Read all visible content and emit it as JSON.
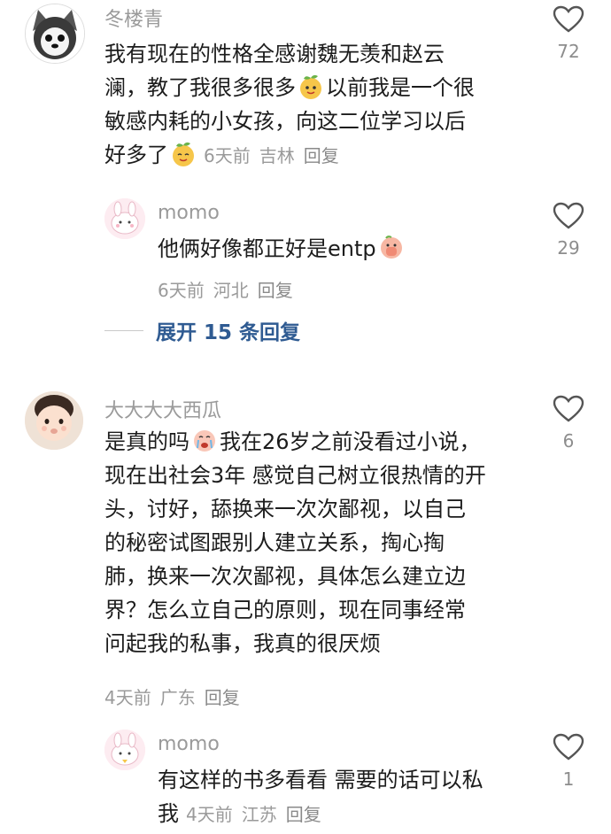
{
  "comments": [
    {
      "username": "冬楼青",
      "lines": [
        "我有现在的性格全感谢魏无羡和赵云",
        "澜，教了我很多很多",
        "以前我是一个很",
        "敏感内耗的小女孩，向这二位学习以后",
        "好多了"
      ],
      "time": "6天前",
      "location": "吉林",
      "reply": "回复",
      "likes": "72"
    },
    {
      "username": "momo",
      "lines": [
        "他俩好像都正好是entp"
      ],
      "time": "6天前",
      "location": "河北",
      "reply": "回复",
      "likes": "29"
    },
    {
      "username": "大大大大西瓜",
      "lines": [
        "是真的吗",
        "我在26岁之前没看过小说，",
        "现在出社会3年 感觉自己树立很热情的开",
        "头，讨好，舔换来一次次鄙视，以自己",
        "的秘密试图跟别人建立关系，掏心掏",
        "肺，换来一次次鄙视，具体怎么建立边",
        "界？怎么立自己的原则，现在同事经常",
        "问起我的私事，我真的很厌烦"
      ],
      "time": "4天前",
      "location": "广东",
      "reply": "回复",
      "likes": "6"
    },
    {
      "username": "momo",
      "lines": [
        "有这样的书多看看 需要的话可以私",
        "我"
      ],
      "time": "4天前",
      "location": "江苏",
      "reply": "回复",
      "likes": "1"
    }
  ],
  "expand_replies": "展开 15 条回复",
  "colors": {
    "meta": "#9a9a9a",
    "expand": "#2f5b92",
    "text": "#1c1c1c"
  }
}
